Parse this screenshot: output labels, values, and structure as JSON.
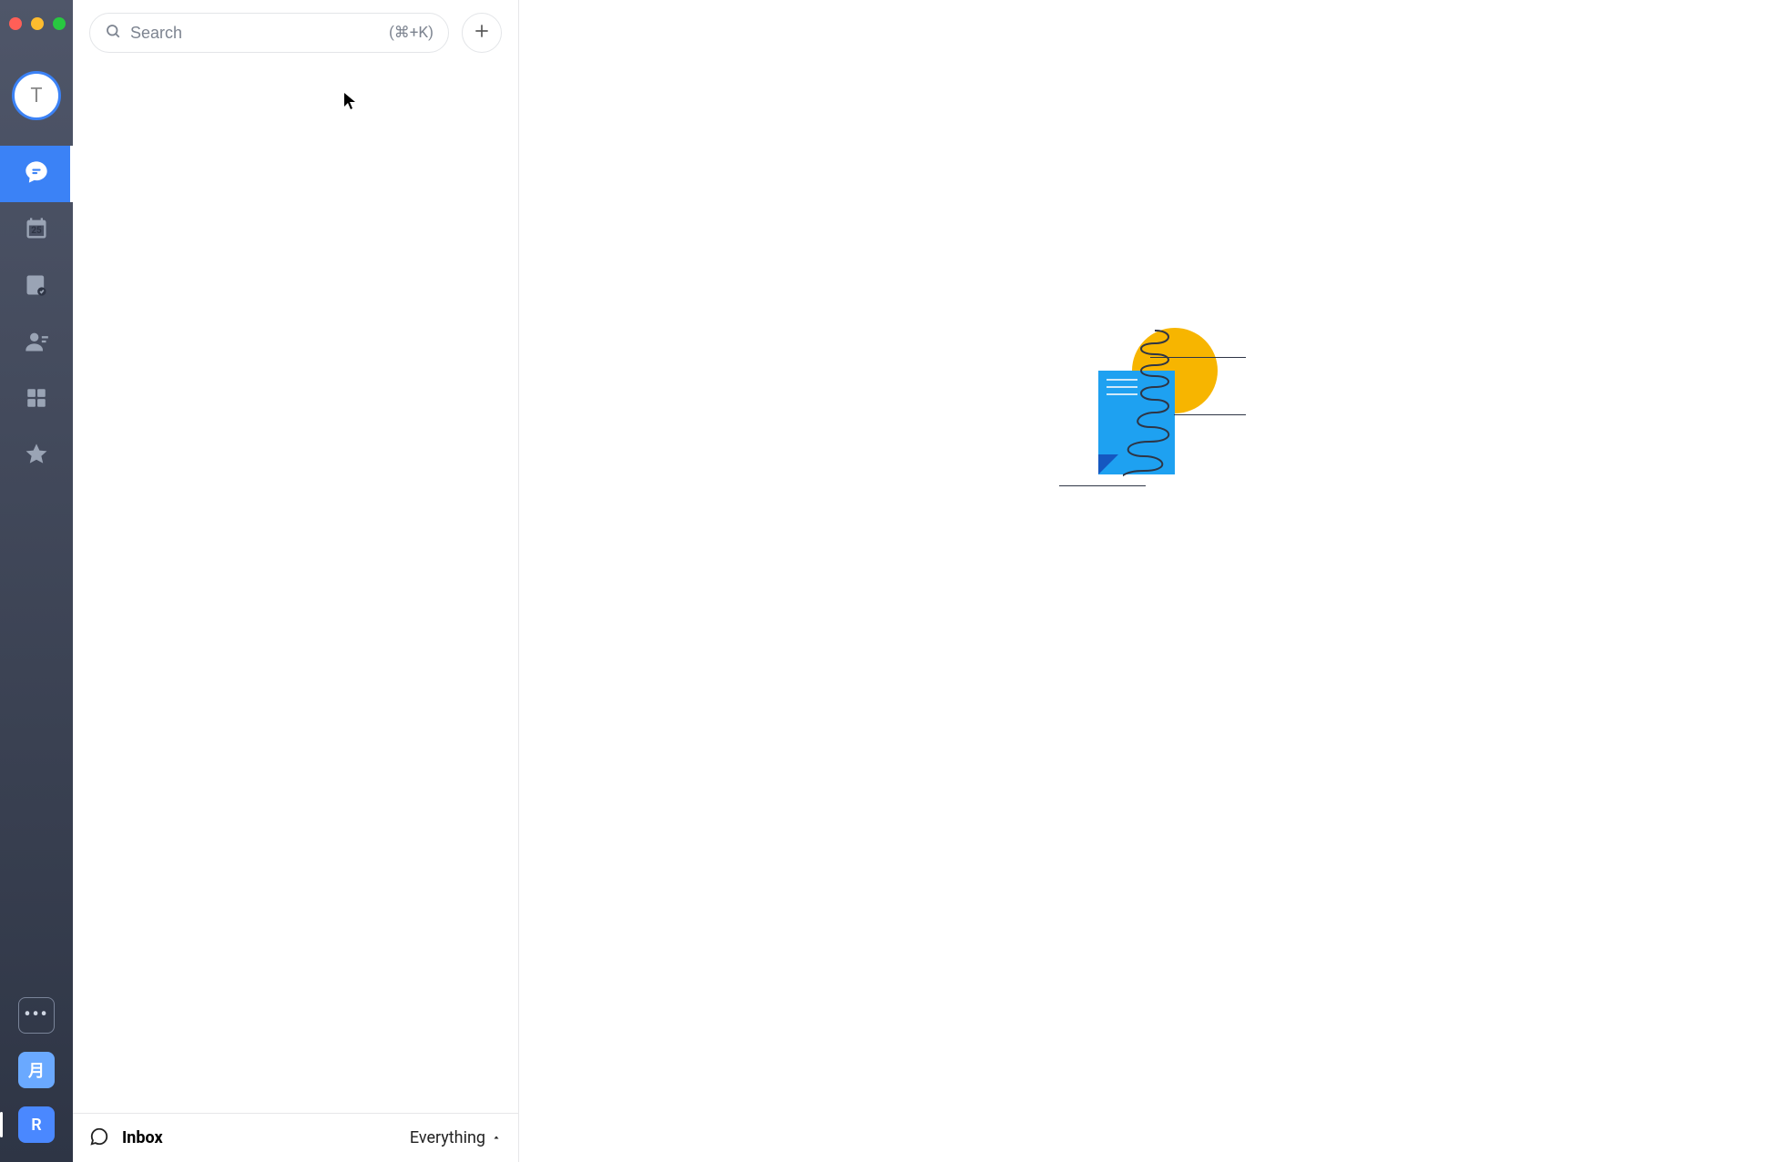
{
  "sidebar": {
    "avatar_initial": "T",
    "nav": {
      "chat_label": "Chats",
      "calendar_day": "25",
      "notes_label": "Notes",
      "contacts_label": "Contacts",
      "apps_label": "Apps",
      "starred_label": "Starred"
    },
    "bottom": {
      "more_label": "•••",
      "tile1_label": "月",
      "tile2_label": "R"
    }
  },
  "search": {
    "placeholder": "Search",
    "shortcut": "(⌘+K)"
  },
  "footer": {
    "title": "Inbox",
    "filter_label": "Everything"
  }
}
